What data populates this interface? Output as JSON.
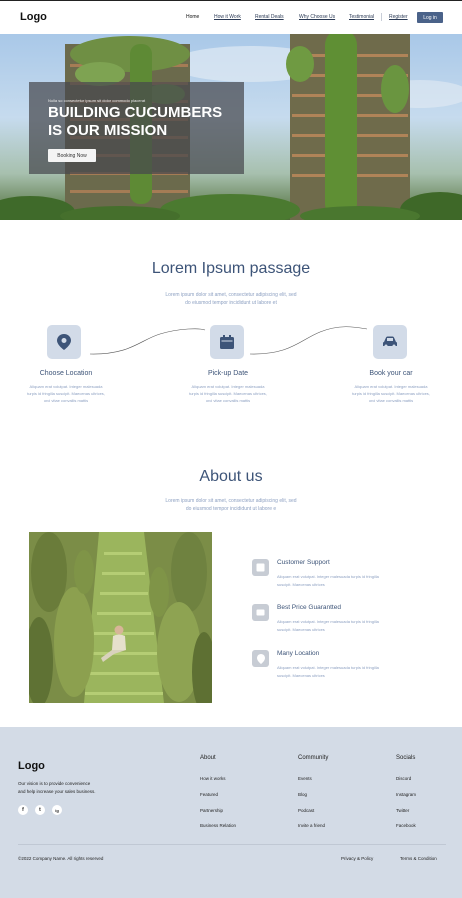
{
  "nav": {
    "logo": "Logo",
    "links": [
      "Home",
      "How it Work",
      "Rental Deals",
      "Why Choose Us",
      "Testimonial"
    ],
    "register": "Register",
    "login": "Log in"
  },
  "hero": {
    "small_text": "Nulla so consectetur ipsum sit dolor commodo placerat",
    "title": "BUILDING CUCUMBERS IS OUR MISSION",
    "button": "Booking Now"
  },
  "steps_section": {
    "title": "Lorem Ipsum passage",
    "subtitle_line1": "Lorem ipsum dolor sit amet, consectetur adipiscing elit, sed",
    "subtitle_line2": "do eiusmod tempor incididunt ut labore et",
    "steps": [
      {
        "icon": "location-pin-icon",
        "title": "Choose Location",
        "desc1": "Aliquam erat volutpat. Integer malesuada",
        "desc2": "turpis id fringilla suscipit. Maecenas ultrices,",
        "desc3": "orci vitae convallis mattis"
      },
      {
        "icon": "calendar-icon",
        "title": "Pick-up Date",
        "desc1": "Aliquam erat volutpat. Integer malesuada",
        "desc2": "turpis id fringilla suscipit. Maecenas ultrices,",
        "desc3": "orci vitae convallis mattis"
      },
      {
        "icon": "car-icon",
        "title": "Book your car",
        "desc1": "Aliquam erat volutpat. Integer malesuada",
        "desc2": "turpis id fringilla suscipit. Maecenas ultrices,",
        "desc3": "orci vitae convallis mattis"
      }
    ]
  },
  "about": {
    "title": "About us",
    "subtitle_line1": "Lorem ipsum dolor sit amet, consectetur adipiscing elit, sed",
    "subtitle_line2": "do eiusmod tempor incididunt ut labore e",
    "features": [
      {
        "title": "Customer Support",
        "desc1": "Aliquam erat volutpat. Integer malesuada turpis id fringilla",
        "desc2": "suscipit. Maecenas ultrices"
      },
      {
        "title": "Best Price Guarantted",
        "desc1": "Aliquam erat volutpat. Integer malesuada turpis id fringilla",
        "desc2": "suscipit. Maecenas ultrices"
      },
      {
        "title": "Many Location",
        "desc1": "Aliquam erat volutpat. Integer malesuada turpis id fringilla",
        "desc2": "suscipit. Maecenas ultrices"
      }
    ]
  },
  "footer": {
    "logo": "Logo",
    "vision_line1": "Our vision is to provide convenience",
    "vision_line2": "and help increase your sales business.",
    "socials_icons": [
      "f",
      "t",
      "ig"
    ],
    "columns": [
      {
        "title": "About",
        "links": [
          "How it works",
          "Featured",
          "Partnership",
          "Business Relation"
        ]
      },
      {
        "title": "Community",
        "links": [
          "Events",
          "Blog",
          "Podcast",
          "Invite a friend"
        ]
      },
      {
        "title": "Socials",
        "links": [
          "Discord",
          "Instagram",
          "Twitter",
          "Facebook"
        ]
      }
    ],
    "copyright": "©2022 Company Name. All rights reserved",
    "privacy": "Privacy & Policy",
    "terms": "Terms & Condition"
  },
  "colors": {
    "accent": "#4a6289",
    "heading": "#3d5478",
    "muted": "#8ea1c2",
    "icon_bg": "#d2dbe8",
    "footer_bg": "#d3dbe6"
  }
}
